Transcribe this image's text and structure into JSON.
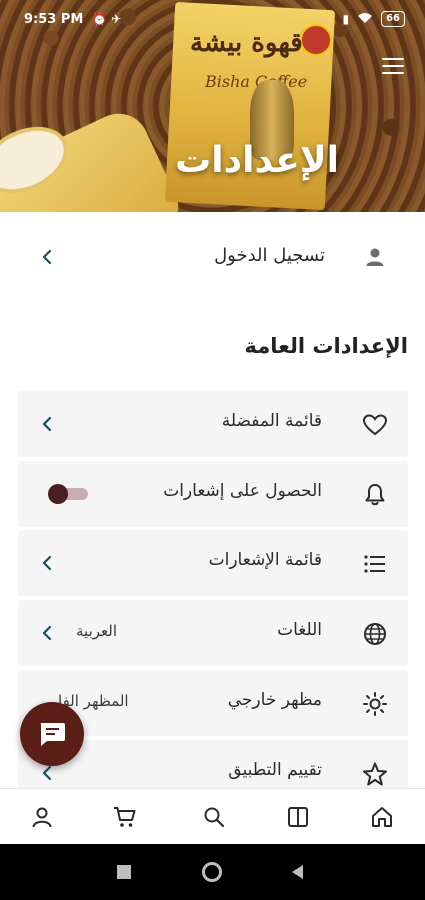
{
  "status_bar": {
    "time": "9:53 PM",
    "battery": "66"
  },
  "hero": {
    "title": "الإعدادات",
    "packet_brand": "قهوة بيشة",
    "packet_brand_latin": "Bisha Coffee"
  },
  "login": {
    "label": "تسجيل الدخول"
  },
  "general_settings": {
    "title": "الإعدادات العامة",
    "items": [
      {
        "label": "قائمة المفضلة",
        "icon": "heart-icon"
      },
      {
        "label": "الحصول على إشعارات",
        "icon": "bell-icon",
        "toggle": "off"
      },
      {
        "label": "قائمة الإشعارات",
        "icon": "list-icon"
      },
      {
        "label": "اللغات",
        "icon": "globe-icon",
        "value": "العربية"
      },
      {
        "label": "مظهر خارجي",
        "icon": "sun-icon",
        "value": "المظهر الفا"
      },
      {
        "label": "تقييم التطبيق",
        "icon": "star-icon"
      }
    ]
  },
  "colors": {
    "accent": "#5a1e17",
    "card_bg": "#f5f5f5",
    "chevron": "#1f4f57"
  },
  "bottom_nav": [
    "profile-icon",
    "cart-icon",
    "search-icon",
    "book-icon",
    "home-icon"
  ]
}
